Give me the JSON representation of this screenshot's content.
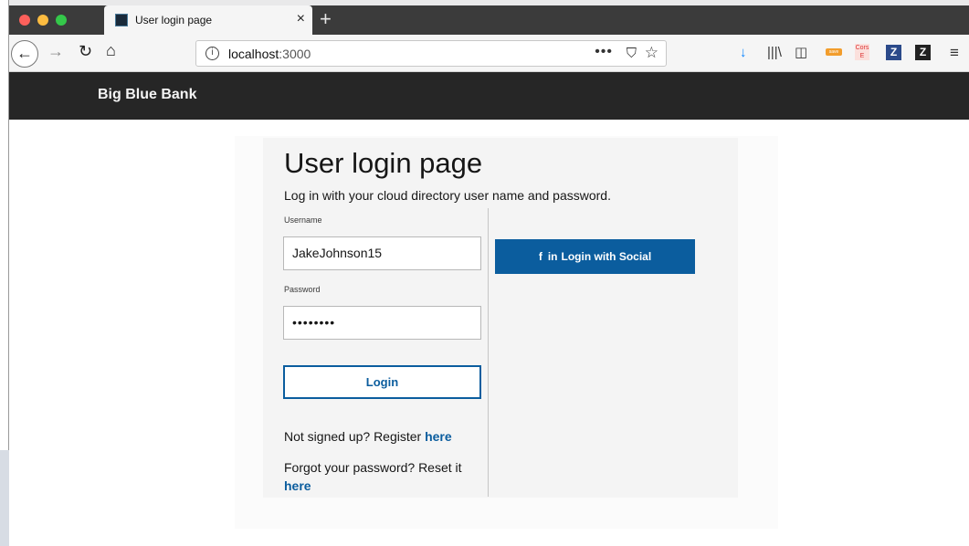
{
  "browser": {
    "tab": {
      "title": "User login page",
      "close": "×"
    },
    "new_tab": "+",
    "nav": {
      "back": "←",
      "forward": "→",
      "reload": "↻",
      "home": "⌂"
    },
    "url": {
      "info_icon": "i",
      "host": "localhost",
      "port": ":3000"
    },
    "url_actions": {
      "more": "•••",
      "pocket": "⛉",
      "star": "☆"
    },
    "toolbar": {
      "download": "↓",
      "library": "|||\\",
      "sidebar": "◫",
      "badge": "save",
      "cors": "Cors E",
      "z1": "Z",
      "z2": "Z",
      "menu": "≡"
    },
    "colors": {
      "tab_strip": "#3b3b3b",
      "accent": "#0a84ff"
    }
  },
  "page": {
    "brand": "Big Blue Bank",
    "title": "User login page",
    "subtitle": "Log in with your cloud directory user name and password.",
    "form": {
      "username_label": "Username",
      "username_value": "JakeJohnson15",
      "password_label": "Password",
      "password_value": "••••••••",
      "login_button": "Login"
    },
    "register": {
      "text": "Not signed up? Register ",
      "link": "here"
    },
    "forgot": {
      "text": "Forgot your password? Reset it ",
      "link": "here"
    },
    "social": {
      "fb_glyph": "f",
      "li_glyph": "in",
      "label": "Login with Social"
    },
    "colors": {
      "masthead": "#262626",
      "primary": "#0b5d9e"
    }
  }
}
